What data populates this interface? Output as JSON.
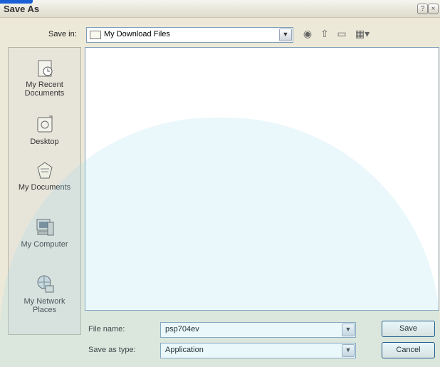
{
  "window": {
    "title": "Save As",
    "help_icon": "help-icon",
    "close_icon": "close-icon"
  },
  "toolbar": {
    "save_in_label": "Save in:",
    "location": "My Download Files",
    "icons": [
      "back-icon",
      "up-folder-icon",
      "new-folder-icon",
      "views-menu-icon"
    ]
  },
  "places": [
    {
      "label": "My Recent Documents",
      "icon": "recent-documents-icon"
    },
    {
      "label": "Desktop",
      "icon": "desktop-icon"
    },
    {
      "label": "My Documents",
      "icon": "my-documents-icon"
    },
    {
      "label": "My Computer",
      "icon": "my-computer-icon"
    },
    {
      "label": "My Network Places",
      "icon": "network-places-icon"
    }
  ],
  "form": {
    "file_name_label": "File name:",
    "file_name_value": "psp704ev",
    "save_type_label": "Save as type:",
    "save_type_value": "Application"
  },
  "buttons": {
    "save": "Save",
    "cancel": "Cancel"
  },
  "colors": {
    "dialog_bg": "#ece9d8",
    "title_accent": "#1a5fd6",
    "field_border": "#7f9db9"
  }
}
